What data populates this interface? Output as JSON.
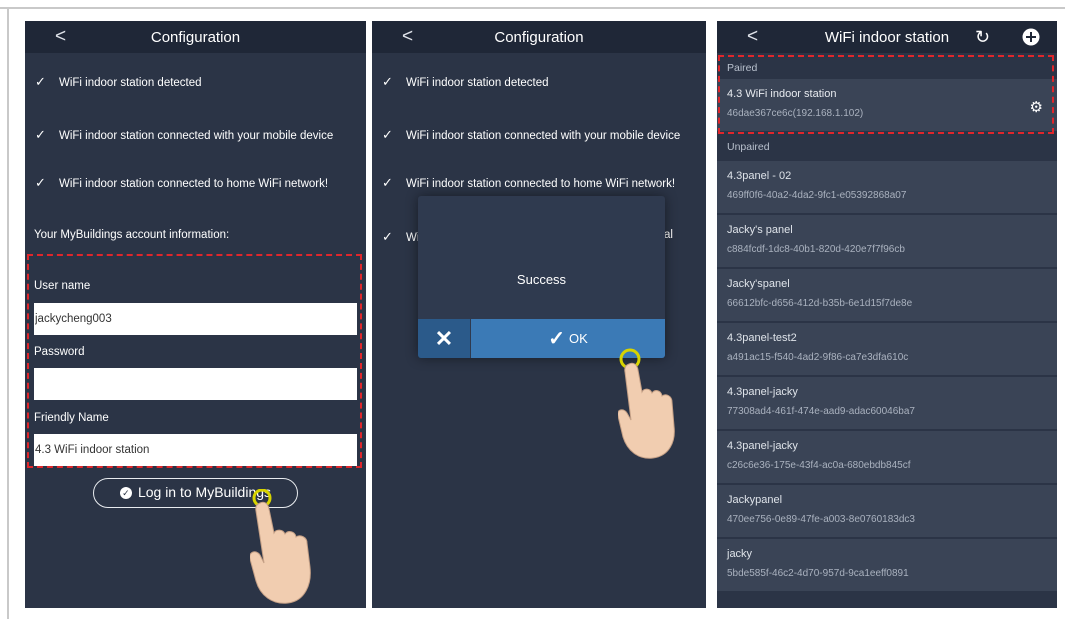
{
  "screen1": {
    "title": "Configuration",
    "back": "<",
    "checks": [
      "WiFi indoor station detected",
      "WiFi indoor station connected with your mobile device",
      "WiFi indoor station connected to home WiFi network!"
    ],
    "account_info": "Your MyBuildings account information:",
    "username_label": "User name",
    "username_value": "jackycheng003",
    "password_label": "Password",
    "password_value": "",
    "friendly_label": "Friendly Name",
    "friendly_value": "4.3 WiFi indoor station",
    "login_button": "Log in to MyBuildings"
  },
  "screen2": {
    "title": "Configuration",
    "back": "<",
    "checks": [
      "WiFi indoor station detected",
      "WiFi indoor station connected with your mobile device",
      "WiFi indoor station connected to home WiFi network!"
    ],
    "fourth_left": "Wi",
    "fourth_right": "al",
    "dialog": {
      "message": "Success",
      "cancel_symbol": "✕",
      "ok_label": "OK"
    }
  },
  "screen3": {
    "title": "WiFi indoor station",
    "back": "<",
    "paired_label": "Paired",
    "paired": {
      "name": "4.3 WiFi indoor station",
      "id": "46dae367ce6c(192.168.1.102)"
    },
    "unpaired_label": "Unpaired",
    "devices": [
      {
        "name": "4.3panel - 02",
        "id": "469ff0f6-40a2-4da2-9fc1-e05392868a07"
      },
      {
        "name": "Jacky's panel",
        "id": "c884fcdf-1dc8-40b1-820d-420e7f7f96cb"
      },
      {
        "name": "Jacky'spanel",
        "id": "66612bfc-d656-412d-b35b-6e1d15f7de8e"
      },
      {
        "name": "4.3panel-test2",
        "id": "a491ac15-f540-4ad2-9f86-ca7e3dfa610c"
      },
      {
        "name": "4.3panel-jacky",
        "id": "77308ad4-461f-474e-aad9-adac60046ba7"
      },
      {
        "name": "4.3panel-jacky",
        "id": "c26c6e36-175e-43f4-ac0a-680ebdb845cf"
      },
      {
        "name": "Jackypanel",
        "id": "470ee756-0e89-47fe-a003-8e0760183dc3"
      },
      {
        "name": "jacky",
        "id": "5bde585f-46c2-4d70-957d-9ca1eeff0891"
      }
    ]
  },
  "colors": {
    "screen_bg": "#2b3446",
    "titlebar": "#1f2737",
    "row_bg": "#3a4456",
    "ok_blue": "#3b7ab6",
    "highlight_dash": "#e0262b"
  },
  "icons": [
    "chevron-left-icon",
    "checkmark-icon",
    "check-circle-icon",
    "close-icon",
    "ok-check-icon",
    "refresh-icon",
    "add-circle-icon",
    "gear-icon",
    "hand-pointer-icon"
  ]
}
